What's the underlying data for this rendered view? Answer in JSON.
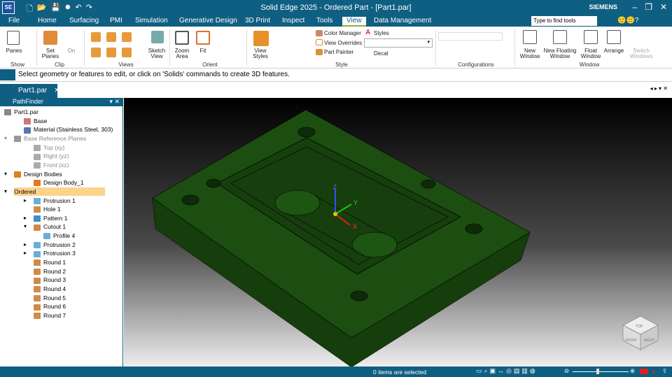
{
  "app": {
    "logo": "SE",
    "title": "Solid Edge 2025 - Ordered Part - [Part1.par]",
    "brand": "SIEMENS",
    "min": "–",
    "restore": "❐",
    "close": "✕"
  },
  "tabs": [
    "File",
    "Home",
    "Surfacing",
    "PMI",
    "Simulation",
    "Generative Design",
    "3D Print",
    "Inspect",
    "Tools",
    "View",
    "Data Management"
  ],
  "search_placeholder": "Type to find tools",
  "ribbon": {
    "show": {
      "panes": "Panes",
      "group": "Show"
    },
    "clip": {
      "set_planes": "Set Planes",
      "on": "On",
      "group": "Clip"
    },
    "views": {
      "sketch_view": "Sketch View",
      "group": "Views"
    },
    "orient": {
      "zoom_area": "Zoom Area",
      "fit": "Fit",
      "group": "Orient"
    },
    "style": {
      "view_styles": "View Styles",
      "color_manager": "Color Manager",
      "styles": "Styles",
      "view_overrides": "View Overrides",
      "part_painter": "Part Painter",
      "decal": "Decal",
      "group": "Style"
    },
    "configurations": {
      "group": "Configurations"
    },
    "window": {
      "new_window": "New Window",
      "new_floating_window": "New Floating Window",
      "float_window": "Float Window",
      "arrange": "Arrange",
      "switch_windows": "Switch Windows",
      "group": "Window"
    }
  },
  "hint": "Select geometry or features to edit, or click on 'Solids' commands to create 3D features.",
  "doc_tab": "Part1.par",
  "pathfinder": {
    "title": "PathFinder",
    "items": [
      {
        "label": "Part1.par",
        "indent": 0,
        "exp": "▾",
        "c": "#888"
      },
      {
        "label": "Base",
        "indent": 2,
        "c": "#c77"
      },
      {
        "label": "Material (Stainless Steel, 303)",
        "indent": 2,
        "c": "#57a"
      },
      {
        "label": "Base Reference Planes",
        "indent": 1,
        "exp": "▾",
        "c": "#999",
        "dim": true
      },
      {
        "label": "Top (xy)",
        "indent": 3,
        "c": "#aaa",
        "dim": true
      },
      {
        "label": "Right (yz)",
        "indent": 3,
        "c": "#aaa",
        "dim": true
      },
      {
        "label": "Front (xz)",
        "indent": 3,
        "c": "#aaa",
        "dim": true
      },
      {
        "label": "Design Bodies",
        "indent": 1,
        "exp": "▾",
        "c": "#e07b1f"
      },
      {
        "label": "Design Body_1",
        "indent": 3,
        "c": "#e07b1f"
      },
      {
        "label": "Ordered",
        "indent": 1,
        "exp": "▾",
        "sel": true
      },
      {
        "label": "Protrusion 1",
        "indent": 3,
        "exp": "▸",
        "c": "#6aaed6"
      },
      {
        "label": "Hole 1",
        "indent": 3,
        "c": "#d08a4a"
      },
      {
        "label": "Pattern 1",
        "indent": 3,
        "exp": "▸",
        "c": "#3a8fd0"
      },
      {
        "label": "Cutout 1",
        "indent": 3,
        "exp": "▾",
        "c": "#d08a4a"
      },
      {
        "label": "Profile 4",
        "indent": 4,
        "c": "#6aaed6"
      },
      {
        "label": "Protrusion 2",
        "indent": 3,
        "exp": "▸",
        "c": "#6aaed6"
      },
      {
        "label": "Protrusion 3",
        "indent": 3,
        "exp": "▸",
        "c": "#6aaed6"
      },
      {
        "label": "Round 1",
        "indent": 3,
        "c": "#d08a4a"
      },
      {
        "label": "Round 2",
        "indent": 3,
        "c": "#d08a4a"
      },
      {
        "label": "Round 3",
        "indent": 3,
        "c": "#d08a4a"
      },
      {
        "label": "Round 4",
        "indent": 3,
        "c": "#d08a4a"
      },
      {
        "label": "Round 5",
        "indent": 3,
        "c": "#d08a4a"
      },
      {
        "label": "Round 6",
        "indent": 3,
        "c": "#d08a4a"
      },
      {
        "label": "Round 7",
        "indent": 3,
        "c": "#d08a4a"
      }
    ]
  },
  "triad": {
    "x": "X",
    "y": "Y",
    "z": "Z"
  },
  "viewcube": {
    "top": "TOP",
    "front": "FRONT",
    "right": "RIGHT"
  },
  "status": {
    "selection": "0 items are selected"
  },
  "colors": {
    "accent": "#0f5f82",
    "model": "#1a4a10"
  }
}
